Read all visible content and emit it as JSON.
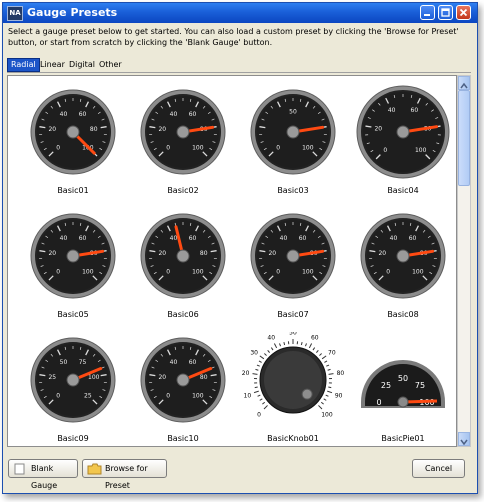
{
  "window": {
    "title": "Gauge Presets",
    "icon_text": "NA"
  },
  "instructions": "Select a gauge preset below to get started.  You can also load a custom preset by clicking the 'Browse for Preset' button, or start from scratch by clicking the 'Blank Gauge' button.",
  "tabs": [
    {
      "label": "Radial",
      "active": true
    },
    {
      "label": "Linear",
      "active": false
    },
    {
      "label": "Digital",
      "active": false
    },
    {
      "label": "Other",
      "active": false
    }
  ],
  "presets": [
    {
      "label": "Basic01",
      "ticks": [
        "0",
        "20",
        "40",
        "60",
        "80",
        "100"
      ],
      "needle_value": 100
    },
    {
      "label": "Basic02",
      "ticks": [
        "0",
        "20",
        "40",
        "60",
        "80",
        "100"
      ],
      "needle_value": 80
    },
    {
      "label": "Basic03",
      "ticks": [
        "0",
        "50",
        "100"
      ],
      "needle_value": 80
    },
    {
      "label": "Basic04",
      "ticks": [
        "0",
        "20",
        "40",
        "60",
        "80",
        "100"
      ],
      "needle_value": 80
    },
    {
      "label": "Basic05",
      "ticks": [
        "0",
        "20",
        "40",
        "60",
        "80",
        "100"
      ],
      "needle_value": 80
    },
    {
      "label": "Basic06",
      "ticks": [
        "0",
        "20",
        "40",
        "60",
        "80",
        "100"
      ],
      "needle_value": 45
    },
    {
      "label": "Basic07",
      "ticks": [
        "0",
        "20",
        "40",
        "60",
        "80",
        "100"
      ],
      "needle_value": 80
    },
    {
      "label": "Basic08",
      "ticks": [
        "0",
        "20",
        "40",
        "60",
        "80",
        "100"
      ],
      "needle_value": 80
    },
    {
      "label": "Basic09",
      "ticks": [
        "0",
        "25",
        "50",
        "75",
        "100",
        "25"
      ],
      "needle_value": 75
    },
    {
      "label": "Basic10",
      "ticks": [
        "0",
        "20",
        "40",
        "60",
        "80",
        "100"
      ],
      "needle_value": 75
    },
    {
      "label": "BasicKnob01",
      "ticks": [
        "0",
        "10",
        "20",
        "30",
        "40",
        "50",
        "60",
        "70",
        "80",
        "90",
        "100"
      ],
      "needle_value": 100
    },
    {
      "label": "BasicPie01",
      "ticks": [
        "0",
        "25",
        "50",
        "75",
        "100"
      ],
      "needle_value": 100
    }
  ],
  "buttons": {
    "blank_gauge": "Blank Gauge",
    "browse_preset": "Browse for Preset",
    "cancel": "Cancel"
  },
  "colors": {
    "needle": "#ff4a12",
    "face": "#1e1e1e",
    "title_bar": "#0b46c1"
  }
}
